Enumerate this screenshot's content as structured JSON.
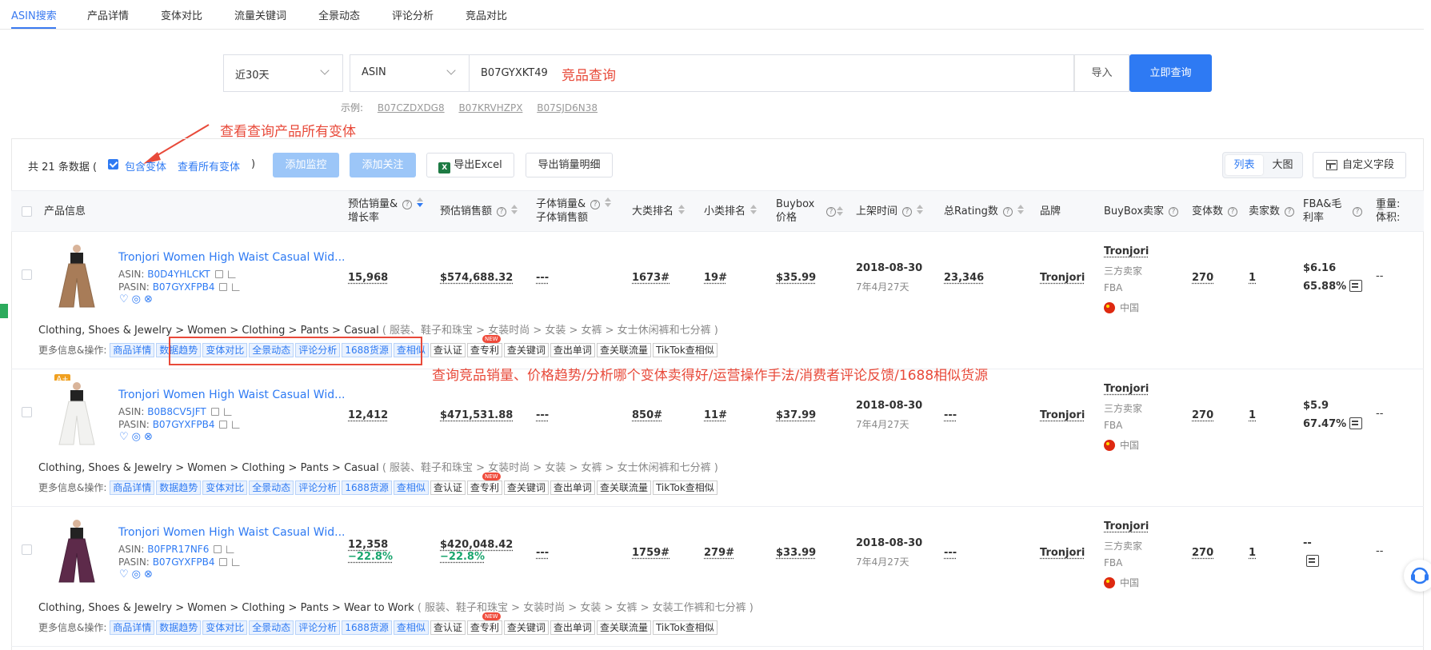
{
  "tabs": [
    {
      "label": "ASIN搜索",
      "active": true
    },
    {
      "label": "产品详情"
    },
    {
      "label": "变体对比"
    },
    {
      "label": "流量关键词"
    },
    {
      "label": "全景动态"
    },
    {
      "label": "评论分析"
    },
    {
      "label": "竞品对比"
    }
  ],
  "search": {
    "period": "近30天",
    "type": "ASIN",
    "value": "B07GYXKT49",
    "import_label": "导入",
    "query_label": "立即查询",
    "examples_label": "示例:",
    "examples": [
      "B07CZDXDG8",
      "B07KRVHZPX",
      "B07SJD6N38"
    ]
  },
  "annotations": {
    "search_note": "竞品查询",
    "variants_note": "查看查询产品所有变体",
    "ops_note": "查询竞品销量、价格趋势/分析哪个变体卖得好/运营操作手法/消费者评论反馈/1688相似货源"
  },
  "toolbar": {
    "total_prefix": "共",
    "total_count": "21",
    "total_suffix": "条数据 (",
    "include_variants": "包含变体",
    "view_all_variants": "查看所有变体",
    "close_paren": ")",
    "add_monitor": "添加监控",
    "add_follow": "添加关注",
    "export_excel": "导出Excel",
    "export_sales": "导出销量明细",
    "view_list": "列表",
    "view_big": "大图",
    "custom_fields": "自定义字段"
  },
  "columns": {
    "product": "产品信息",
    "est_sales": "预估销量&",
    "est_sales2": "增长率",
    "est_revenue": "预估销售额",
    "child_sales": "子体销量&",
    "child_sales2": "子体销售额",
    "main_rank": "大类排名",
    "sub_rank": "小类排名",
    "buybox_price": "Buybox",
    "buybox_price2": "价格",
    "listed": "上架时间",
    "rating_count": "总Rating数",
    "brand": "品牌",
    "buybox_seller": "BuyBox卖家",
    "variant_count": "变体数",
    "seller_count": "卖家数",
    "fba_margin": "FBA&毛",
    "fba_margin2": "利率",
    "weight": "重量:",
    "weight2": "体积:"
  },
  "row_labels": {
    "asin": "ASIN:",
    "pasin": "PASIN:",
    "ops_label": "更多信息&操作:",
    "seller_type": "三方卖家",
    "fulfill": "FBA",
    "country": "中国",
    "new_badge": "NEW",
    "aplus": "A+"
  },
  "ops": [
    "商品详情",
    "数据趋势",
    "变体对比",
    "全景动态",
    "评论分析",
    "1688货源",
    "查相似",
    "查认证",
    "查专利",
    "查关键词",
    "查出单词",
    "查关联流量",
    "TikTok查相似"
  ],
  "rows": [
    {
      "title": "Tronjori Women High Waist Casual Wid...",
      "asin": "B0D4YHLCKT",
      "pasin": "B07GYXFPB4",
      "sales": "15,968",
      "sales_growth": "",
      "revenue": "$574,688.32",
      "revenue_growth": "",
      "child": "---",
      "main_rank": "1673#",
      "sub_rank": "19#",
      "price": "$35.99",
      "listed_date": "2018-08-30",
      "listed_age": "7年4月27天",
      "rating_count": "23,346",
      "brand": "Tronjori",
      "seller": "Tronjori",
      "variants": "270",
      "sellers": "1",
      "fba": "$6.16",
      "margin": "65.88%",
      "weight": "--",
      "category": "Clothing, Shoes & Jewelry > Women > Clothing > Pants > Casual",
      "category_cn": "( 服装、鞋子和珠宝 > 女装时尚 > 女装 > 女裤 > 女士休闲裤和七分裤 )"
    },
    {
      "title": "Tronjori Women High Waist Casual Wid...",
      "asin": "B0B8CV5JFT",
      "pasin": "B07GYXFPB4",
      "sales": "12,412",
      "sales_growth": "",
      "revenue": "$471,531.88",
      "revenue_growth": "",
      "child": "---",
      "main_rank": "850#",
      "sub_rank": "11#",
      "price": "$37.99",
      "listed_date": "2018-08-30",
      "listed_age": "7年4月27天",
      "rating_count": "---",
      "brand": "Tronjori",
      "seller": "Tronjori",
      "variants": "270",
      "sellers": "1",
      "fba": "$5.9",
      "margin": "67.47%",
      "weight": "--",
      "category": "Clothing, Shoes & Jewelry > Women > Clothing > Pants > Casual",
      "category_cn": "( 服装、鞋子和珠宝 > 女装时尚 > 女装 > 女裤 > 女士休闲裤和七分裤 )"
    },
    {
      "title": "Tronjori Women High Waist Casual Wid...",
      "asin": "B0FPR17NF6",
      "pasin": "B07GYXFPB4",
      "sales": "12,358",
      "sales_growth": "−22.8%",
      "revenue": "$420,048.42",
      "revenue_growth": "−22.8%",
      "child": "---",
      "main_rank": "1759#",
      "sub_rank": "279#",
      "price": "$33.99",
      "listed_date": "2018-08-30",
      "listed_age": "7年4月27天",
      "rating_count": "---",
      "brand": "Tronjori",
      "seller": "Tronjori",
      "variants": "270",
      "sellers": "1",
      "fba": "--",
      "margin": "",
      "weight": "--",
      "category": "Clothing, Shoes & Jewelry > Women > Clothing > Pants > Wear to Work",
      "category_cn": "( 服装、鞋子和珠宝 > 女装时尚 > 女装 > 女裤 > 女装工作裤和七分裤 )"
    }
  ]
}
